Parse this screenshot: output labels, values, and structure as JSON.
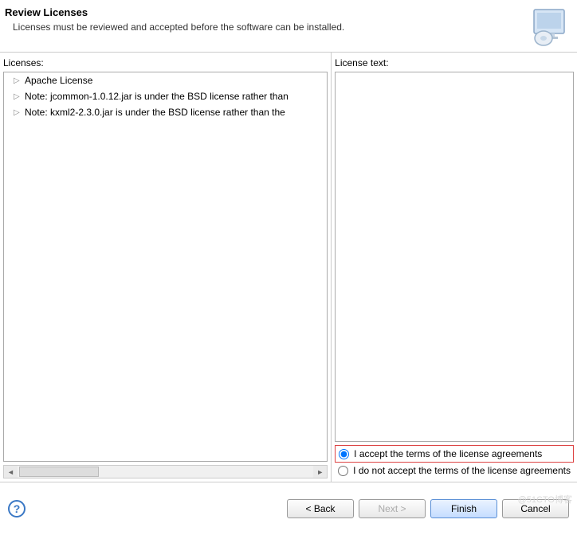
{
  "header": {
    "title": "Review Licenses",
    "subtitle": "Licenses must be reviewed and accepted before the software can be installed."
  },
  "left": {
    "label": "Licenses:",
    "items": [
      "Apache License",
      "Note:  jcommon-1.0.12.jar is under the BSD license rather than",
      "Note:  kxml2-2.3.0.jar is under the BSD license rather than the"
    ]
  },
  "right": {
    "label": "License text:"
  },
  "radios": {
    "accept": "I accept the terms of the license agreements",
    "reject": "I do not accept the terms of the license agreements"
  },
  "buttons": {
    "back": "< Back",
    "next": "Next >",
    "finish": "Finish",
    "cancel": "Cancel"
  },
  "watermark": "@51CTO博客"
}
